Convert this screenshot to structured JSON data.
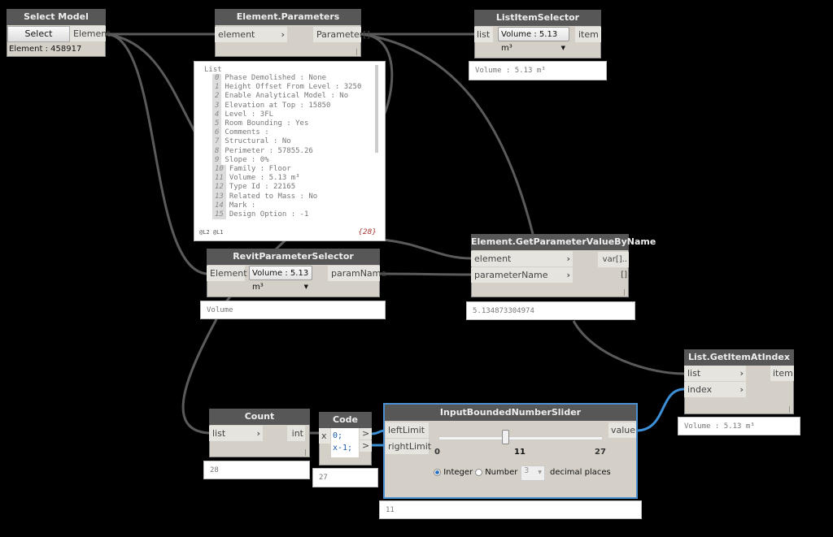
{
  "select_model_element": {
    "title": "Select Model Element",
    "button": "Select",
    "output": "Element",
    "info": "Element : 458917"
  },
  "element_parameters": {
    "title": "Element.Parameters",
    "input": "element",
    "output": "Parameter[]",
    "preview": {
      "header": "List",
      "items": [
        {
          "i": "0",
          "t": "Phase Demolished : None"
        },
        {
          "i": "1",
          "t": "Height Offset From Level : 3250"
        },
        {
          "i": "2",
          "t": "Enable Analytical Model : No"
        },
        {
          "i": "3",
          "t": "Elevation at Top : 15850"
        },
        {
          "i": "4",
          "t": "Level : 3FL"
        },
        {
          "i": "5",
          "t": "Room Bounding : Yes"
        },
        {
          "i": "6",
          "t": "Comments :"
        },
        {
          "i": "7",
          "t": "Structural : No"
        },
        {
          "i": "8",
          "t": "Perimeter : 57855.26"
        },
        {
          "i": "9",
          "t": "Slope : 0%"
        },
        {
          "i": "10",
          "t": "Family : Floor"
        },
        {
          "i": "11",
          "t": "Volume : 5.13 m³"
        },
        {
          "i": "12",
          "t": "Type Id : 22165"
        },
        {
          "i": "13",
          "t": "Related to Mass : No"
        },
        {
          "i": "14",
          "t": "Mark :"
        },
        {
          "i": "15",
          "t": "Design Option : -1"
        }
      ],
      "levels": "@L2 @L1",
      "count": "{28}"
    }
  },
  "list_item_selector": {
    "title": "ListItemSelector",
    "input": "list",
    "selected": "Volume : 5.13 m³",
    "output": "item",
    "preview": "Volume : 5.13 m³"
  },
  "revit_parameter_selector": {
    "title": "RevitParameterSelector",
    "input": "Element",
    "selected": "Volume : 5.13 m³",
    "output": "paramName",
    "preview": "Volume"
  },
  "get_parameter_value": {
    "title": "Element.GetParameterValueByName",
    "inputs": [
      "element",
      "parameterName"
    ],
    "output": "var[]..[]",
    "preview": "5.134873304974"
  },
  "get_item_at_index": {
    "title": "List.GetItemAtIndex",
    "inputs": [
      "list",
      "index"
    ],
    "output": "item",
    "preview": "Volume : 5.13 m³"
  },
  "count": {
    "title": "Count",
    "input": "list",
    "output": "int",
    "preview": "28"
  },
  "code_block": {
    "title": "Code Block",
    "input": "x",
    "lines": [
      "0;",
      "x-1;"
    ],
    "outputs": [
      ">",
      ">"
    ],
    "preview": "27"
  },
  "slider": {
    "title": "InputBoundedNumberSlider",
    "inputs": [
      "leftLimit",
      "rightLimit"
    ],
    "output": "value",
    "min": "0",
    "value": "11",
    "max": "27",
    "value_fraction": 0.407,
    "mode_integer": "Integer",
    "mode_number": "Number",
    "selected_mode": "Integer",
    "decimals": "3",
    "decimals_label": "decimal places",
    "preview": "11"
  },
  "colors": {
    "background": "#000000",
    "node_header": "#575757",
    "node_body": "#d4d0c8",
    "wire": "#5a5a5a",
    "selected_wire": "#3d8fd6"
  }
}
